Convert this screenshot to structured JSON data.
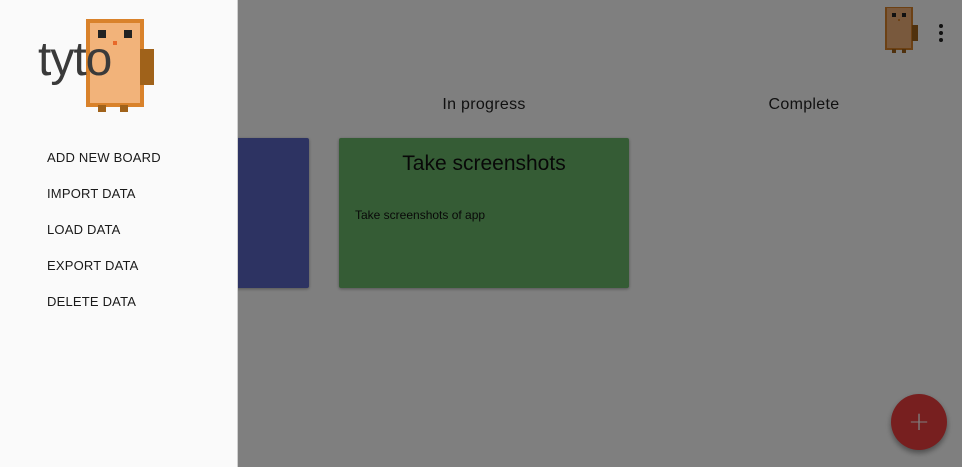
{
  "board": {
    "columns": [
      {
        "title": ""
      },
      {
        "title": "In progress"
      },
      {
        "title": "Complete"
      }
    ],
    "cards": [
      {
        "title": "",
        "description": "",
        "color": "#5a66c4"
      },
      {
        "title": "Take screenshots",
        "description": "Take screenshots of app",
        "color": "#6bb96a"
      }
    ],
    "fab_icon": "+"
  },
  "topbar": {
    "avatar_icon": "owl-avatar-icon",
    "menu_icon": "more-vert-icon"
  },
  "drawer": {
    "logo_text": "tyto",
    "menu": [
      {
        "label": "ADD NEW BOARD"
      },
      {
        "label": "IMPORT DATA"
      },
      {
        "label": "LOAD DATA"
      },
      {
        "label": "EXPORT DATA"
      },
      {
        "label": "DELETE DATA"
      }
    ]
  },
  "colors": {
    "scrim": "rgba(0,0,0,0.5)",
    "fab": "#ef3f3f",
    "owl_body": "#f2b37a",
    "owl_outline": "#d9822b",
    "owl_wing": "#a0621a"
  }
}
